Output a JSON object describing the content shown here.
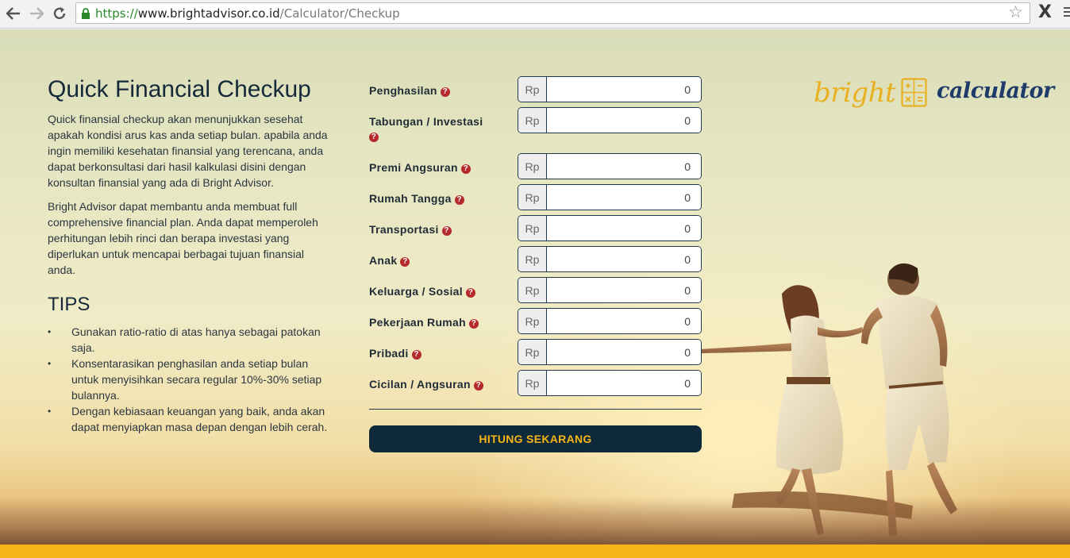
{
  "browser": {
    "url_scheme": "https://",
    "url_host": "www.brightadvisor.co.id",
    "url_path": "/Calculator/Checkup",
    "back_icon": "arrow-left-icon",
    "forward_icon": "arrow-right-icon",
    "reload_icon": "reload-icon",
    "bookmark_icon": "star-icon",
    "extension_label": "X",
    "menu_icon": "hamburger-icon"
  },
  "intro": {
    "title": "Quick Financial Checkup",
    "paragraph1": "Quick finansial checkup akan menunjukkan sesehat apakah kondisi arus kas anda setiap bulan. apabila anda ingin memiliki kesehatan finansial yang terencana, anda dapat berkonsultasi dari hasil kalkulasi disini dengan konsultan finansial yang ada di Bright Advisor.",
    "paragraph2": "Bright Advisor dapat membantu anda membuat full comprehensive financial plan. Anda dapat memperoleh perhitungan lebih rinci dan berapa investasi yang diperlukan untuk mencapai berbagai tujuan finansial anda.",
    "tips_title": "TIPS",
    "tips": [
      "Gunakan ratio-ratio di atas hanya sebagai patokan saja.",
      "Konsentarasikan penghasilan anda setiap bulan untuk menyisihkan secara regular 10%-30% setiap bulannya.",
      "Dengan kebiasaan keuangan yang baik, anda akan dapat menyiapkan masa depan dengan lebih cerah."
    ]
  },
  "form": {
    "currency": "Rp",
    "help_glyph": "?",
    "fields": [
      {
        "label": "Penghasilan",
        "value": "0"
      },
      {
        "label": "Tabungan / Investasi",
        "value": "0"
      },
      {
        "label": "Premi Angsuran",
        "value": "0"
      },
      {
        "label": "Rumah Tangga",
        "value": "0"
      },
      {
        "label": "Transportasi",
        "value": "0"
      },
      {
        "label": "Anak",
        "value": "0"
      },
      {
        "label": "Keluarga / Sosial",
        "value": "0"
      },
      {
        "label": "Pekerjaan Rumah",
        "value": "0"
      },
      {
        "label": "Pribadi",
        "value": "0"
      },
      {
        "label": "Cicilan / Angsuran",
        "value": "0"
      }
    ],
    "submit_label": "HITUNG SEKARANG"
  },
  "logo": {
    "word1": "bright",
    "word2": "calculator",
    "icon": "calculator-icon"
  },
  "colors": {
    "accent": "#f5b516",
    "navy": "#0e2a3a",
    "help_red": "#b5282c"
  }
}
